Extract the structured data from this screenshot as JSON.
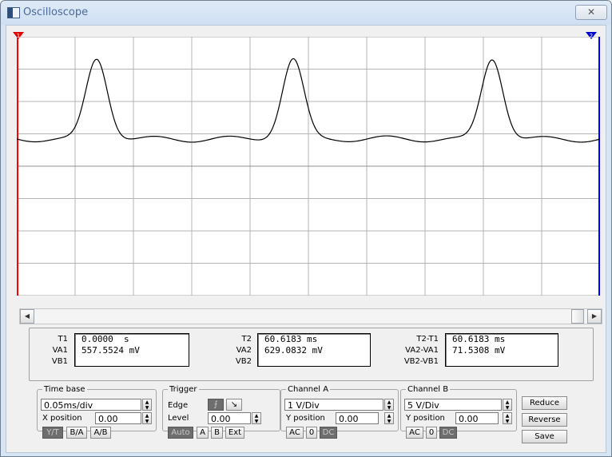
{
  "window": {
    "title": "Oscilloscope",
    "close_glyph": "✕"
  },
  "screen": {
    "background": "#ffffff",
    "grid_color": "#b4b4b4",
    "trace_color": "#000000",
    "cursor1": {
      "label": "1",
      "color": "#ff0000"
    },
    "cursor2": {
      "label": "2",
      "color": "#0000ff"
    }
  },
  "scrollbar": {
    "left_arrow": "◀",
    "right_arrow": "▶"
  },
  "readouts": {
    "t1": {
      "labels": [
        "T1",
        "VA1",
        "VB1"
      ],
      "values": [
        "0.0000  s",
        "557.5524 mV",
        ""
      ]
    },
    "t2": {
      "labels": [
        "T2",
        "VA2",
        "VB2"
      ],
      "values": [
        "60.6183 ms",
        "629.0832 mV",
        ""
      ]
    },
    "diff": {
      "labels": [
        "T2-T1",
        "VA2-VA1",
        "VB2-VB1"
      ],
      "values": [
        "60.6183 ms",
        "71.5308 mV",
        ""
      ]
    }
  },
  "timebase": {
    "legend": "Time base",
    "scale": "0.05ms/div",
    "xpos_label": "X position",
    "xpos": "0.00",
    "modes": [
      "Y/T",
      "B/A",
      "A/B"
    ],
    "active_mode": "Y/T"
  },
  "trigger": {
    "legend": "Trigger",
    "edge_label": "Edge",
    "level_label": "Level",
    "level": "0.00",
    "sources": [
      "Auto",
      "A",
      "B",
      "Ext"
    ]
  },
  "channel_a": {
    "legend": "Channel A",
    "scale": "1 V/Div",
    "ypos_label": "Y position",
    "ypos": "0.00",
    "couplings": [
      "AC",
      "0",
      "DC"
    ]
  },
  "channel_b": {
    "legend": "Channel B",
    "scale": "5 V/Div",
    "ypos_label": "Y position",
    "ypos": "0.00",
    "couplings": [
      "AC",
      "0",
      "DC"
    ]
  },
  "actions": {
    "reduce": "Reduce",
    "reverse": "Reverse",
    "save": "Save"
  }
}
